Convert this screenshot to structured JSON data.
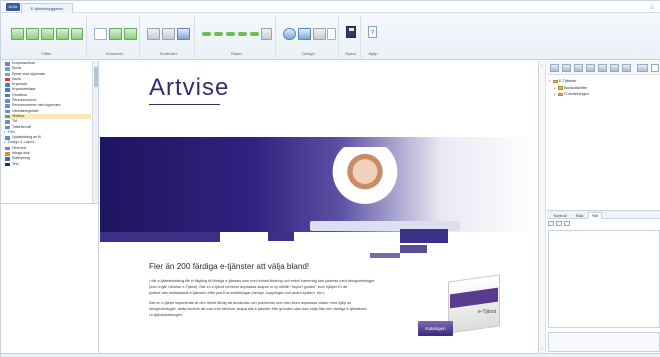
{
  "window": {
    "app_button": "AXIA",
    "document_tab": "E-tjänstebyggaren"
  },
  "ribbon": {
    "groups": [
      {
        "label": "Fälter"
      },
      {
        "label": "Kolumner"
      },
      {
        "label": "Kontroller"
      },
      {
        "label": "Rader"
      },
      {
        "label": "Design"
      },
      {
        "label": "Spara"
      },
      {
        "label": "Hjälp"
      }
    ]
  },
  "toolbox": {
    "items": [
      {
        "label": "Dropdownlista",
        "icon": "dropdown-icon",
        "color": "#5b8bc9"
      },
      {
        "label": "Epost",
        "icon": "email-icon",
        "color": "#7aa0cf"
      },
      {
        "label": "Epost med signerare",
        "icon": "email-sign-icon",
        "color": "#7aa0cf"
      },
      {
        "label": "Karta",
        "icon": "map-pin-icon",
        "color": "#d93a2e"
      },
      {
        "label": "Kryssruta",
        "icon": "checkbox-icon",
        "color": "#4a7bc0"
      },
      {
        "label": "Kryssruteslista",
        "icon": "checkbox-list-icon",
        "color": "#4a7bc0"
      },
      {
        "label": "Omräkna",
        "icon": "calc-icon",
        "color": "#4a7bc0"
      },
      {
        "label": "Personnummer",
        "icon": "id-icon",
        "color": "#6a8fc2"
      },
      {
        "label": "Personnummer med signerare",
        "icon": "id-sign-icon",
        "color": "#6a8fc2"
      },
      {
        "label": "Utbetalningslider",
        "icon": "slider-icon",
        "color": "#6a8fc2"
      },
      {
        "label": "Textbox",
        "icon": "textbox-icon",
        "color": "#6a8fc2",
        "selected": true
      },
      {
        "label": "Tid",
        "icon": "time-icon",
        "color": "#6a8fc2"
      },
      {
        "label": "Tidsintervall",
        "icon": "time-range-icon",
        "color": "#6a8fc2"
      }
    ],
    "sections": [
      {
        "label": "Filer",
        "items": [
          {
            "label": "Uppladdning av fil",
            "icon": "upload-icon",
            "color": "#5b8bc9"
          }
        ]
      },
      {
        "label": "Design & Layout",
        "items": [
          {
            "label": "Html text",
            "icon": "html-icon",
            "color": "#5b8bc9"
          },
          {
            "label": "Infoga länk",
            "icon": "link-icon",
            "color": "#e08a2a"
          },
          {
            "label": "Sidbrytning",
            "icon": "page-break-icon",
            "color": "#3b6fb5"
          },
          {
            "label": "Text",
            "icon": "text-icon",
            "color": "#333333"
          }
        ]
      }
    ]
  },
  "canvas": {
    "logo_text": "Artvise",
    "heading": "Fler än 200 färdiga e-tjänster att välja bland!",
    "paragraphs": [
      "I vår e-tjänstekatalog får ni tillgång till färdiga e-tjänster som med enkelt ändring och enkel hantering kan justeras med designverktyget",
      "(som ingår i Artvise e-Tjänst). När en e-tjänst behöver anpassas skapar ni ny utifrån \"Import guiden\" som hjälper Er att",
      "justera den nedladdade e-tjänsten efter just Era inställningar (design, kopplingar mot andra system, etc.).",
      "När en e-tjänst importerats är den direkt färdig att användas och publiceras men kan även anpassas vidare med hjälp av",
      "designverktyget. detta innebär att man inte behöver skapa alla e-tjänster från grunden utan kan välja från den färdiga e-tjänsterna",
      "i e-tjänstekatalogen."
    ],
    "catalog_label": "Katalogen",
    "catalog_side": "e-Tjänst"
  },
  "explorer": {
    "tree": [
      {
        "label": "E-Tjänster",
        "level": 0
      },
      {
        "label": "Bankutskrifter",
        "level": 1
      },
      {
        "label": "IT-avdelningen",
        "level": 1
      }
    ]
  },
  "properties": {
    "tabs": [
      {
        "label": "Kontroll"
      },
      {
        "label": "Sida"
      },
      {
        "label": "Fält",
        "active": true
      }
    ]
  }
}
